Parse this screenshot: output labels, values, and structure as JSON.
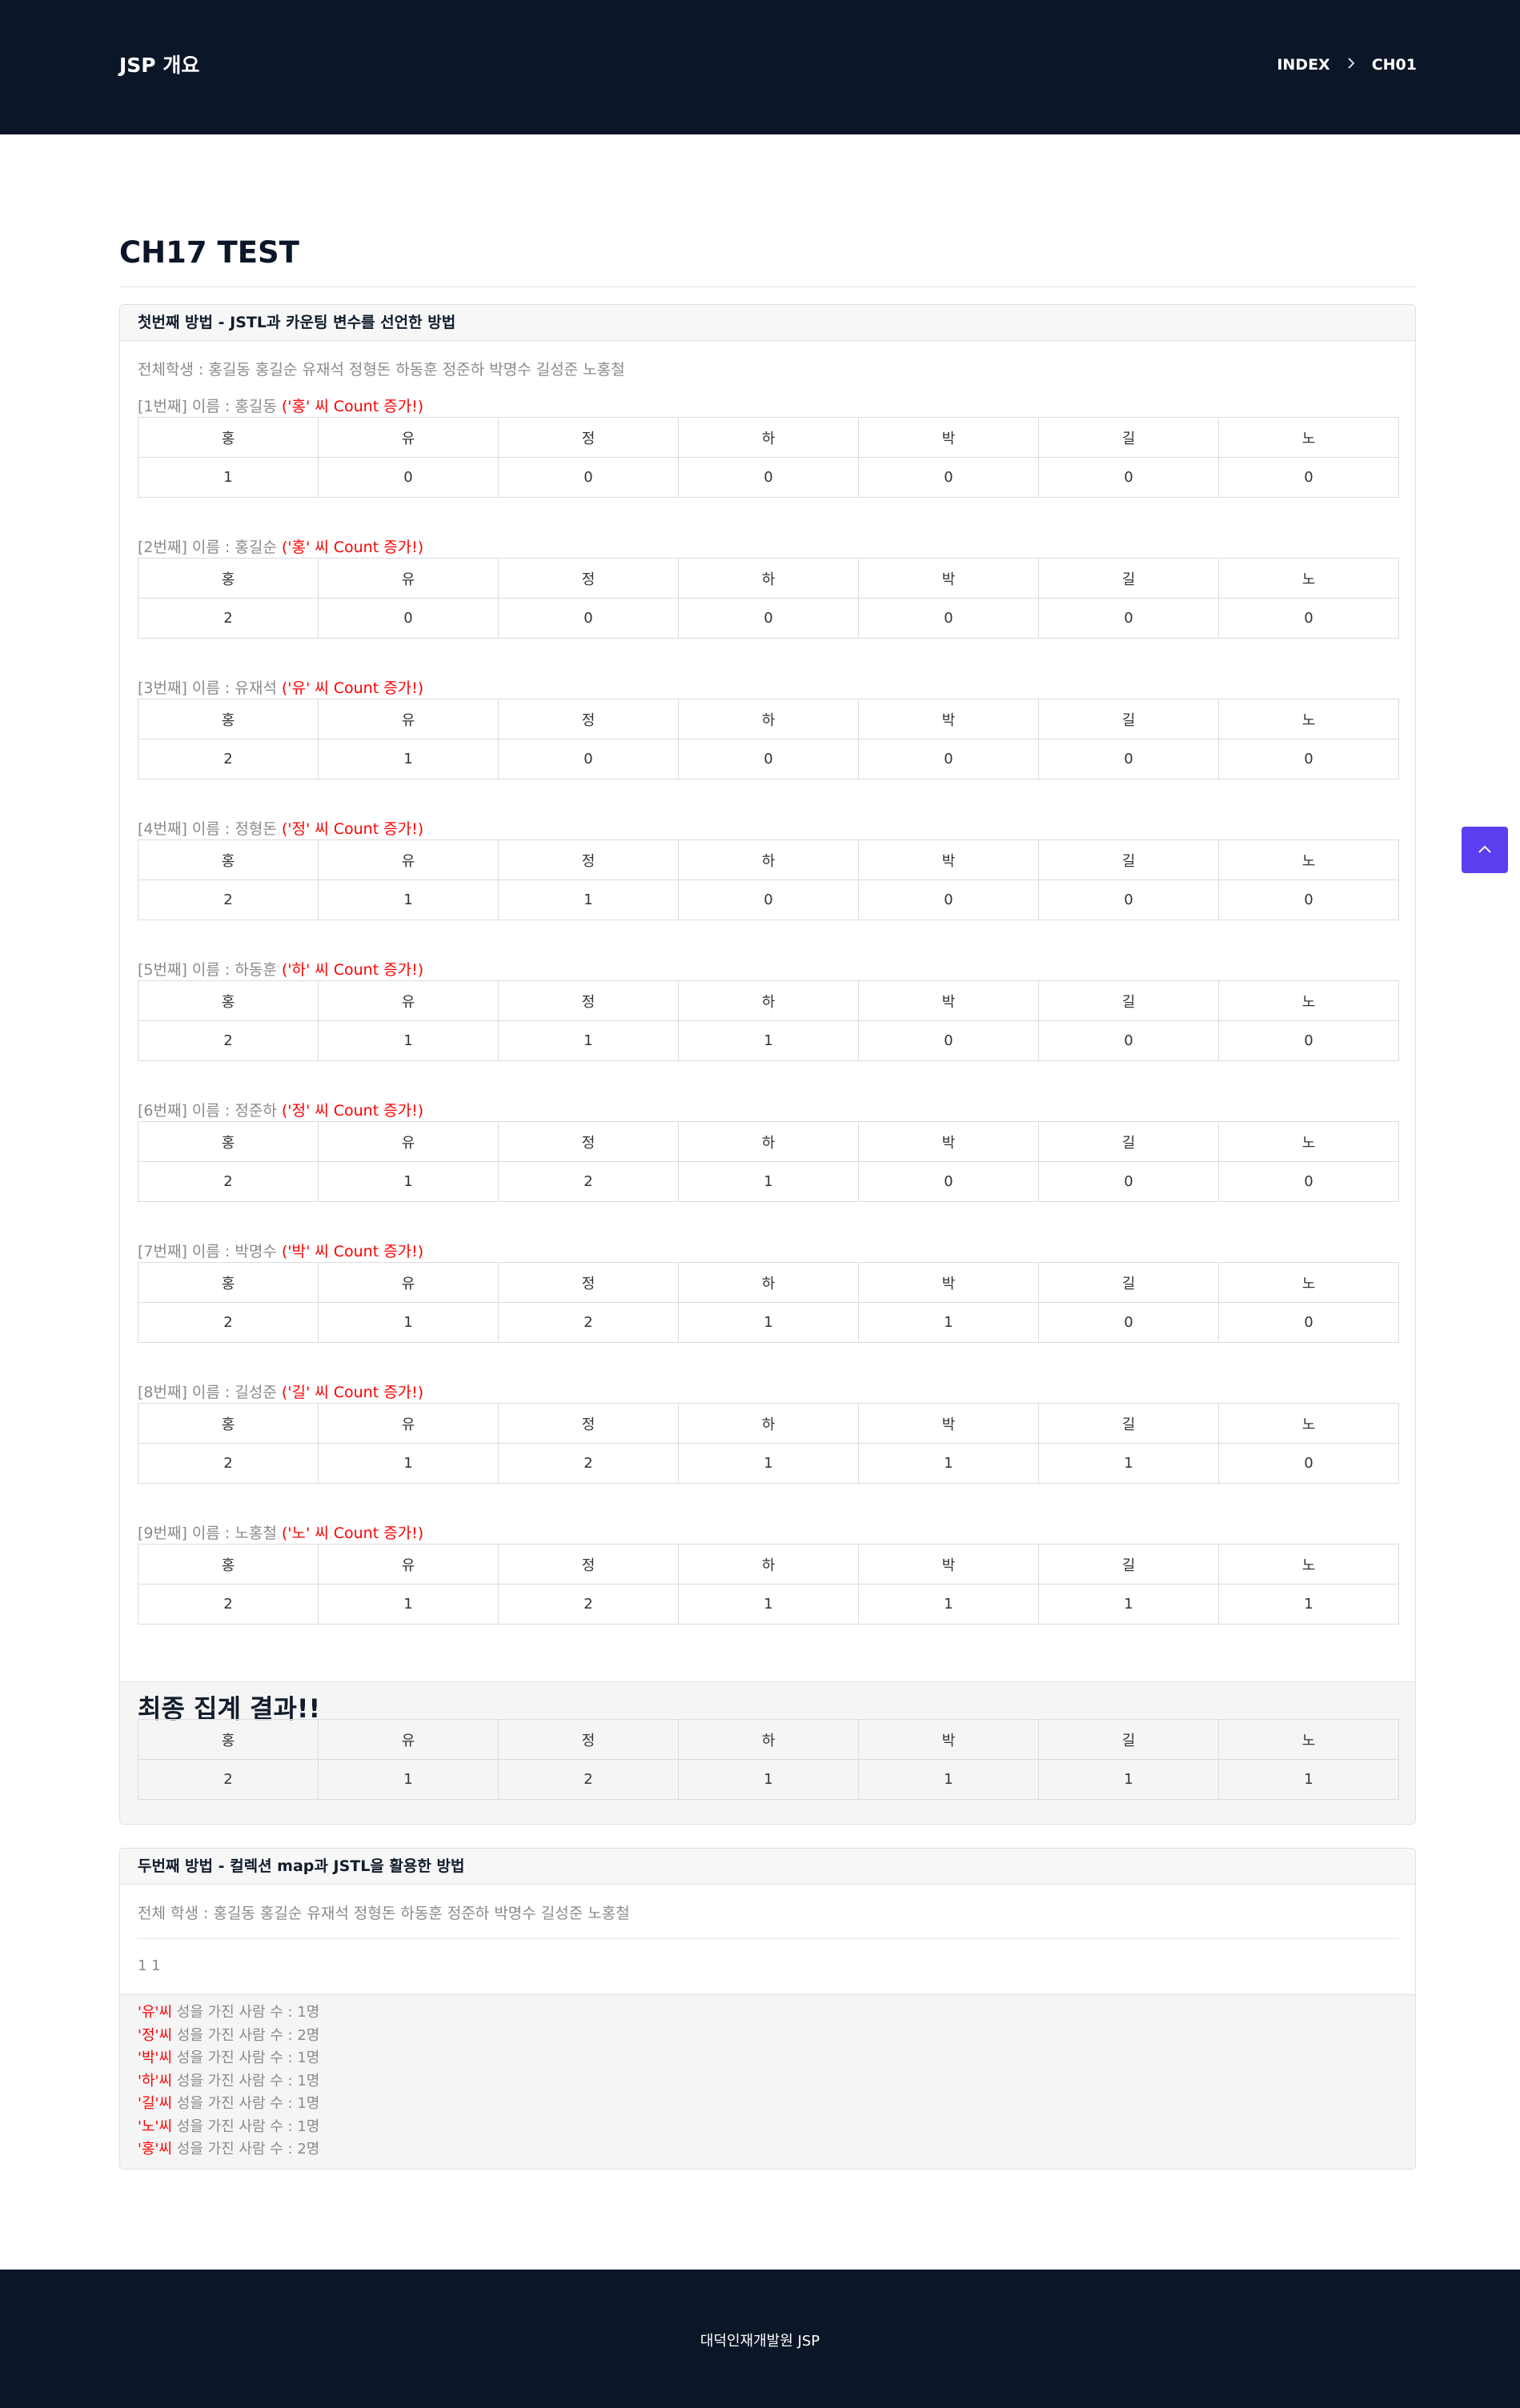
{
  "header": {
    "brand": "JSP 개요",
    "breadcrumb": [
      "INDEX",
      "CH01"
    ]
  },
  "page_title": "CH17 TEST",
  "section1": {
    "title": "첫번째 방법 - JSTL과 카운팅 변수를 선언한 방법",
    "students": "전체학생 : 홍길동 홍길순 유재석 정형돈 하동훈 정준하 박명수 길성준 노홍철",
    "columns": [
      "홍",
      "유",
      "정",
      "하",
      "박",
      "길",
      "노"
    ],
    "steps": [
      {
        "label": "[1번째] 이름 : 홍길동",
        "note": "('홍' 씨 Count 증가!)",
        "values": [
          "1",
          "0",
          "0",
          "0",
          "0",
          "0",
          "0"
        ]
      },
      {
        "label": "[2번째] 이름 : 홍길순",
        "note": "('홍' 씨 Count 증가!)",
        "values": [
          "2",
          "0",
          "0",
          "0",
          "0",
          "0",
          "0"
        ]
      },
      {
        "label": "[3번째] 이름 : 유재석",
        "note": "('유' 씨 Count 증가!)",
        "values": [
          "2",
          "1",
          "0",
          "0",
          "0",
          "0",
          "0"
        ]
      },
      {
        "label": "[4번째] 이름 : 정형돈",
        "note": "('정' 씨 Count 증가!)",
        "values": [
          "2",
          "1",
          "1",
          "0",
          "0",
          "0",
          "0"
        ]
      },
      {
        "label": "[5번째] 이름 : 하동훈",
        "note": "('하' 씨 Count 증가!)",
        "values": [
          "2",
          "1",
          "1",
          "1",
          "0",
          "0",
          "0"
        ]
      },
      {
        "label": "[6번째] 이름 : 정준하",
        "note": "('정' 씨 Count 증가!)",
        "values": [
          "2",
          "1",
          "2",
          "1",
          "0",
          "0",
          "0"
        ]
      },
      {
        "label": "[7번째] 이름 : 박명수",
        "note": "('박' 씨 Count 증가!)",
        "values": [
          "2",
          "1",
          "2",
          "1",
          "1",
          "0",
          "0"
        ]
      },
      {
        "label": "[8번째] 이름 : 길성준",
        "note": "('길' 씨 Count 증가!)",
        "values": [
          "2",
          "1",
          "2",
          "1",
          "1",
          "1",
          "0"
        ]
      },
      {
        "label": "[9번째] 이름 : 노홍철",
        "note": "('노' 씨 Count 증가!)",
        "values": [
          "2",
          "1",
          "2",
          "1",
          "1",
          "1",
          "1"
        ]
      }
    ],
    "final_title": "최종 집계 결과!!",
    "final_values": [
      "2",
      "1",
      "2",
      "1",
      "1",
      "1",
      "1"
    ]
  },
  "section2": {
    "title": "두번째 방법 - 컬렉션 map과 JSTL을 활용한 방법",
    "students": "전체 학생 : 홍길동 홍길순 유재석 정형돈 하동훈 정준하 박명수 길성준 노홍철",
    "counter": "1 1",
    "results": [
      {
        "surname": "'유'씨",
        "text": " 성을 가진 사람 수 : 1명"
      },
      {
        "surname": "'정'씨",
        "text": " 성을 가진 사람 수 : 2명"
      },
      {
        "surname": "'박'씨",
        "text": " 성을 가진 사람 수 : 1명"
      },
      {
        "surname": "'하'씨",
        "text": " 성을 가진 사람 수 : 1명"
      },
      {
        "surname": "'길'씨",
        "text": " 성을 가진 사람 수 : 1명"
      },
      {
        "surname": "'노'씨",
        "text": " 성을 가진 사람 수 : 1명"
      },
      {
        "surname": "'홍'씨",
        "text": " 성을 가진 사람 수 : 2명"
      }
    ]
  },
  "footer": {
    "copyright": "대덕인재개발원 JSP"
  },
  "icons": {
    "top_button": "chevron-up-icon",
    "breadcrumb_separator": "chevron-right-icon"
  },
  "colors": {
    "header_bg": "#0b1628",
    "accent": "#5b3ef0",
    "highlight": "#ff0000"
  }
}
